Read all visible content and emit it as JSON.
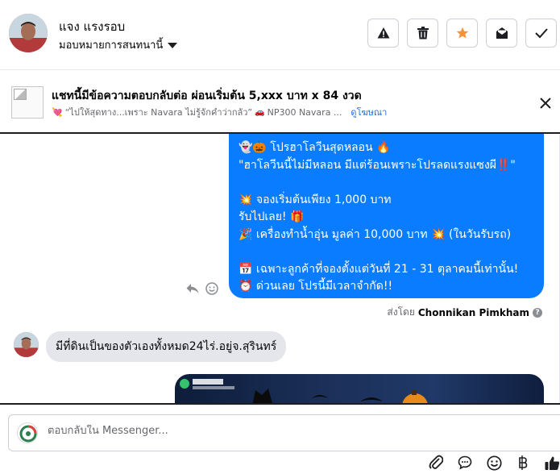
{
  "header": {
    "contact_name": "แจง แรงรอบ",
    "assign_label": "มอบหมายการสนทนานี้"
  },
  "ad_bar": {
    "title": "แชทนี้มีข้อความตอบกลับต่อ ผ่อนเริ่มต้น 5,xxx บาท x 84 งวด",
    "subtitle": "“ไปให้สุดทาง...เพราะ Navara ไม่รู้จักคำว่ากลัว”",
    "subtitle2": "NP300 Navara ...",
    "link_label": "ดูโฆษณา"
  },
  "thread": {
    "outgoing_lines": [
      "👻🎃 โปรฮาโลวีนสุดหลอน 🔥",
      "\"ฮาโลวีนนี้ไม่มีหลอน มีแต่ร้อนเพราะโปรลดแรงแซงผี‼️\"",
      "",
      "💥 จองเริ่มต้นเพียง 1,000 บาท",
      "รับไปเลย! 🎁",
      "🎉 เครื่องทำน้ำอุ่น มูลค่า 10,000 บาท 💥 (ในวันรับรถ)",
      "",
      "📅 เฉพาะลูกค้าที่จองตั้งแต่วันที่ 21 - 31 ตุลาคมนี้เท่านั้น!",
      "⏰ ด่วนเลย โปรนี้มีเวลาจำกัด!!"
    ],
    "sent_by_prefix": "ส่งโดย",
    "sent_by_name": "Chonnikan Pimkham",
    "incoming_message": "มีที่ดินเป็นของตัวเองทั้งหมด24ไร่.อยู่จ.สุรินทร์"
  },
  "composer": {
    "placeholder": "ตอบกลับใน Messenger..."
  },
  "colors": {
    "outgoing_bubble": "#0a7cff",
    "incoming_bubble": "#e4e6eb",
    "star_accent": "#f7923b",
    "link": "#216fdb"
  }
}
